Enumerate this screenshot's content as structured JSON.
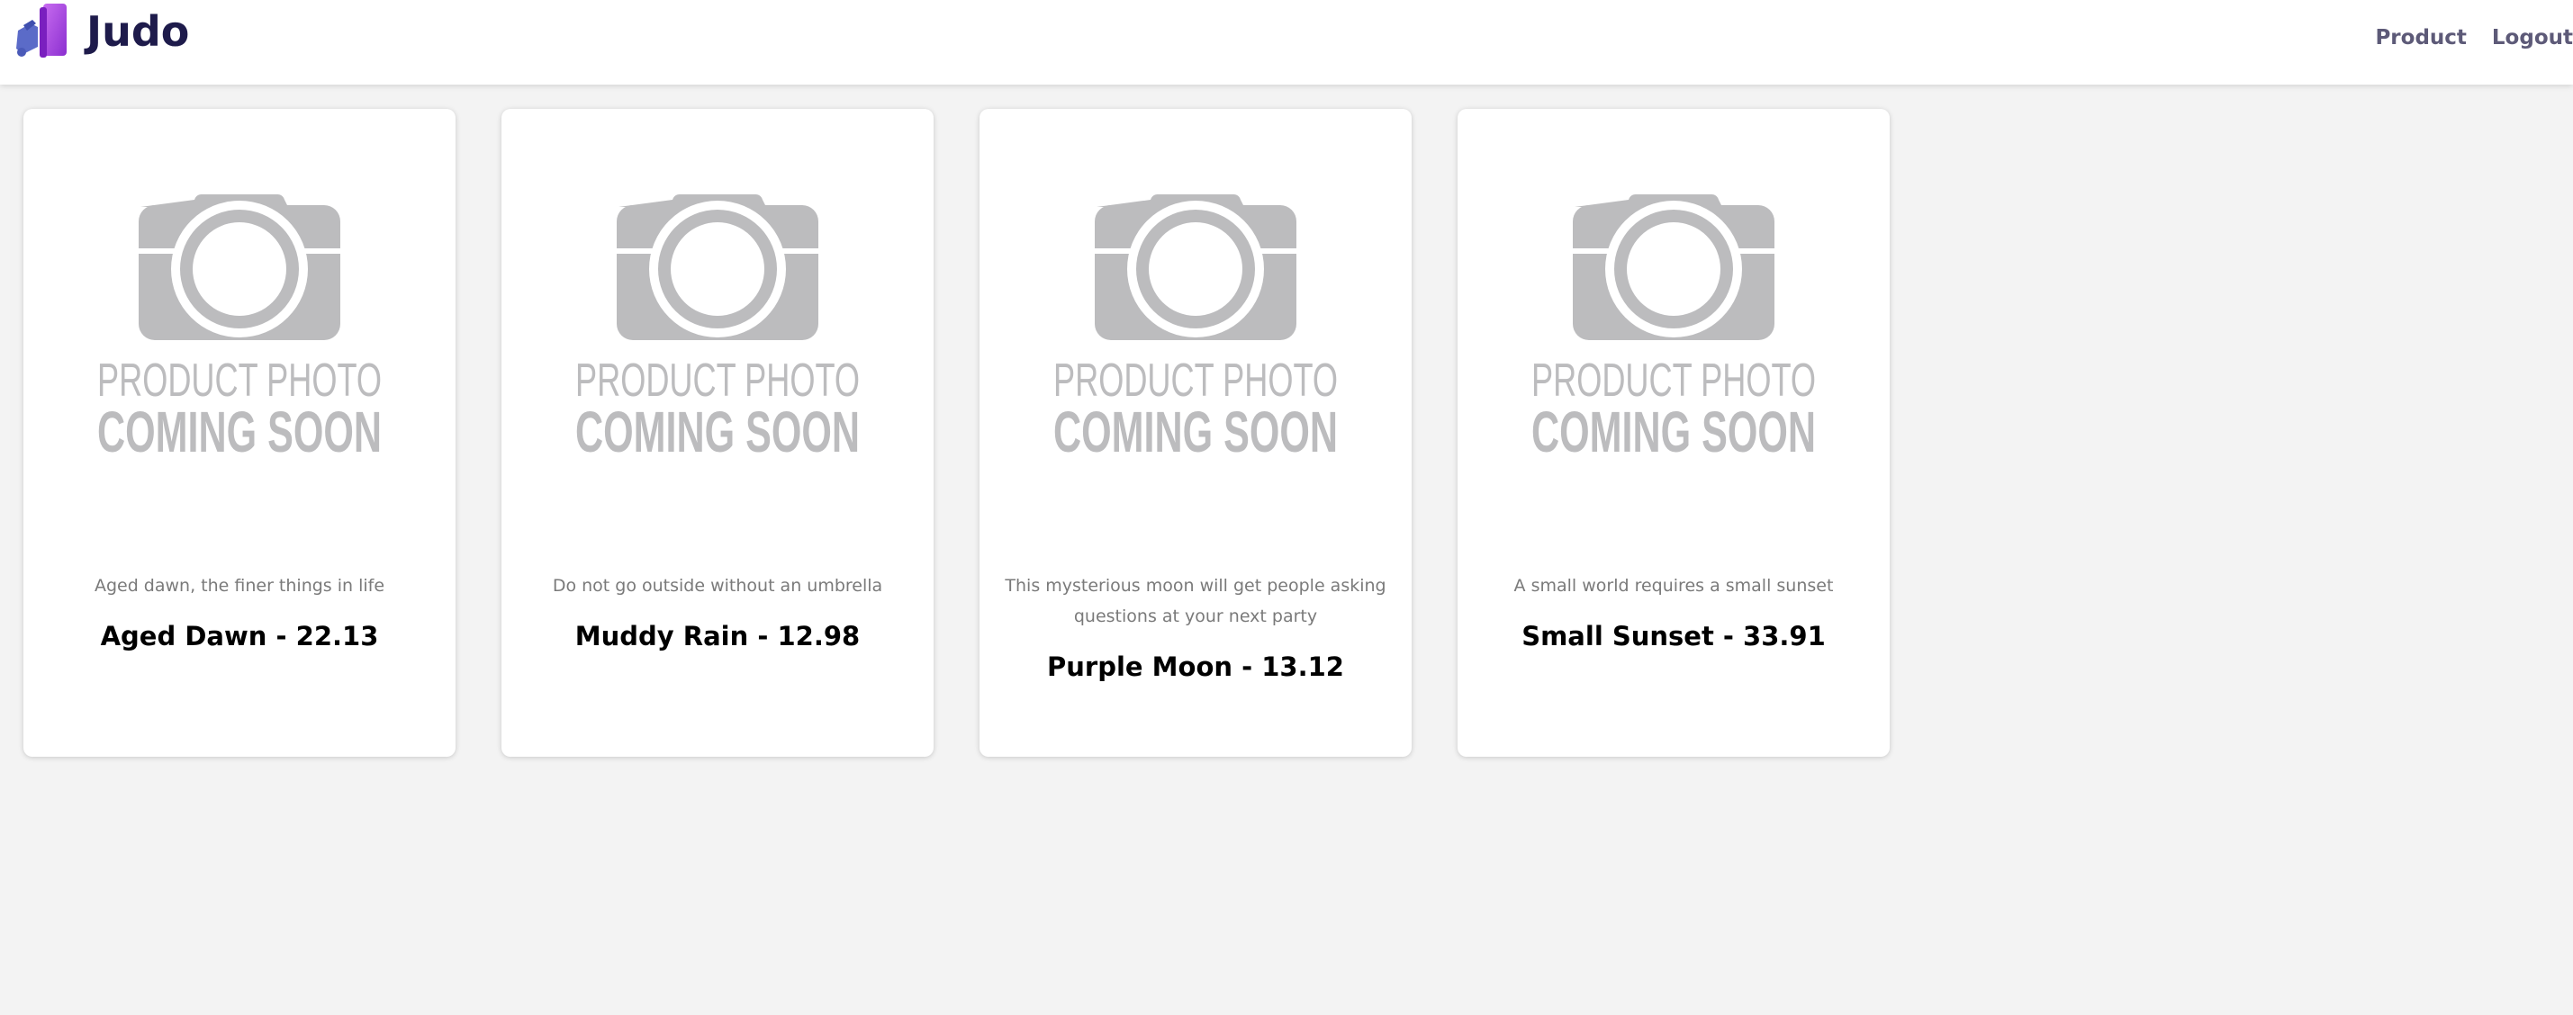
{
  "brand": {
    "name": "Judo",
    "logo_icon": "judo-logo-icon"
  },
  "nav": {
    "product": "Product",
    "logout": "Logout"
  },
  "placeholder": {
    "line1": "PRODUCT PHOTO",
    "line2": "COMING SOON",
    "color": "#bcbcbe"
  },
  "products": [
    {
      "description": "Aged dawn, the finer things in life",
      "title": "Aged Dawn - 22.13"
    },
    {
      "description": "Do not go outside without an umbrella",
      "title": "Muddy Rain - 12.98"
    },
    {
      "description": "This mysterious moon will get people asking questions at your next party",
      "title": "Purple Moon - 13.12"
    },
    {
      "description": "A small world requires a small sunset",
      "title": "Small Sunset - 33.91"
    }
  ]
}
